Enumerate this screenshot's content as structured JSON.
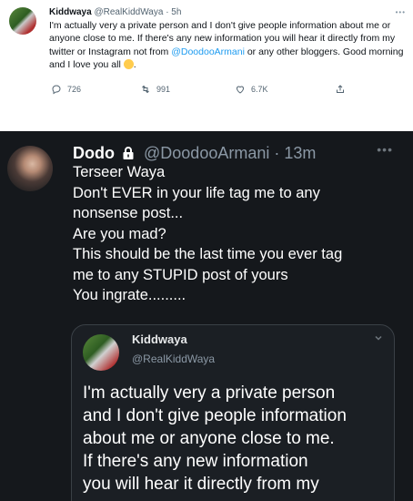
{
  "top_tweet": {
    "display_name": "Kiddwaya",
    "handle": "@RealKiddWaya",
    "time": "5h",
    "text_part1": "I'm actually very a private person and I don't give people information about me or anyone close to me. If there's any new information you will hear it directly from my twitter or Instagram not from ",
    "mention": "@DoodooArmani",
    "text_part2": " or any other bloggers. Good morning and I love you all ",
    "emoji": "smiling-face-emoji",
    "replies": "726",
    "retweets": "991",
    "likes": "6.7K",
    "icons": [
      "reply-icon",
      "retweet-icon",
      "like-icon",
      "share-icon"
    ]
  },
  "dark_tweet": {
    "display_name": "Dodo",
    "handle": "@DoodooArmani",
    "time": "13m",
    "lines": [
      "Terseer Waya",
      "Don't EVER in your life tag me to any",
      "nonsense post...",
      "Are you mad?",
      "This should be the last time you ever tag",
      "me to any STUPID post of yours",
      "You ingrate........."
    ],
    "quote": {
      "display_name": "Kiddwaya",
      "handle": "@RealKiddWaya",
      "lines": [
        "I'm actually very a private person",
        "and I don't give people information",
        "about me or anyone close to me.",
        "If there's any new information",
        "you will hear it directly from my"
      ]
    }
  },
  "colors": {
    "link": "#1d9bf0",
    "dark_bg": "#15181c",
    "light_text": "#0f1419",
    "muted": "#536471"
  }
}
